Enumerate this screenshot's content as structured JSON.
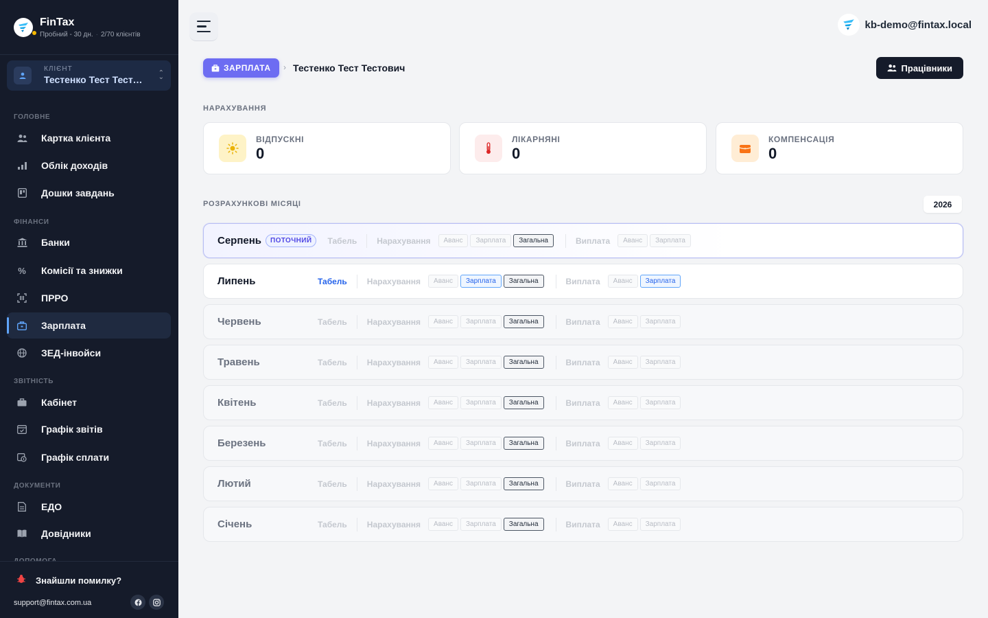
{
  "brand": {
    "name": "FinTax",
    "trial": "Пробний - 30 дн.",
    "clients": "2/70 клієнтів"
  },
  "client": {
    "label": "КЛІЄНТ",
    "name": "Тестенко Тест Тестович"
  },
  "nav": {
    "section_main": "ГОЛОВНЕ",
    "section_finance": "ФІНАНСИ",
    "section_reports": "ЗВІТНІСТЬ",
    "section_docs": "ДОКУМЕНТИ",
    "section_help": "ДОПОМОГА",
    "items": [
      {
        "label": "Картка клієнта",
        "icon": "users-icon"
      },
      {
        "label": "Облік доходів",
        "icon": "bar-chart-icon"
      },
      {
        "label": "Дошки завдань",
        "icon": "kanban-icon"
      },
      {
        "label": "Банки",
        "icon": "bank-icon"
      },
      {
        "label": "Комісії та знижки",
        "icon": "percent-icon"
      },
      {
        "label": "ПРРО",
        "icon": "scan-icon"
      },
      {
        "label": "Зарплата",
        "icon": "salary-icon"
      },
      {
        "label": "ЗЕД-інвойси",
        "icon": "globe-icon"
      },
      {
        "label": "Кабінет",
        "icon": "briefcase-icon"
      },
      {
        "label": "Графік звітів",
        "icon": "calendar-icon"
      },
      {
        "label": "Графік сплати",
        "icon": "payment-schedule-icon"
      },
      {
        "label": "ЕДО",
        "icon": "document-icon"
      },
      {
        "label": "Довідники",
        "icon": "book-icon"
      }
    ]
  },
  "footer": {
    "bug": "Знайшли помилку?",
    "email": "support@fintax.com.ua"
  },
  "header": {
    "user_email": "kb-demo@fintax.local"
  },
  "breadcrumb": {
    "badge": "ЗАРПЛАТА",
    "separator": "›",
    "name": "Тестенко Тест Тестович"
  },
  "workers_button": "Працівники",
  "accruals": {
    "title": "НАРАХУВАННЯ",
    "cards": [
      {
        "label": "ВІДПУСКНІ",
        "value": "0"
      },
      {
        "label": "ЛІКАРНЯНІ",
        "value": "0"
      },
      {
        "label": "КОМПЕНСАЦІЯ",
        "value": "0"
      }
    ]
  },
  "months": {
    "title": "РОЗРАХУНКОВІ МІСЯЦІ",
    "year": "2026",
    "current_badge": "ПОТОЧНИЙ",
    "tabel": "Табель",
    "accrual": "Нарахування",
    "payout": "Виплата",
    "chip_advance": "Аванс",
    "chip_salary": "Зарплата",
    "chip_total": "Загальна",
    "rows": [
      {
        "name": "Серпень"
      },
      {
        "name": "Липень"
      },
      {
        "name": "Червень"
      },
      {
        "name": "Травень"
      },
      {
        "name": "Квітень"
      },
      {
        "name": "Березень"
      },
      {
        "name": "Лютий"
      },
      {
        "name": "Січень"
      }
    ]
  },
  "colors": {
    "accent": "#6d6cf2",
    "sidebar": "#151b2a",
    "active_blue": "#2563eb",
    "background": "#f3f4f6"
  }
}
